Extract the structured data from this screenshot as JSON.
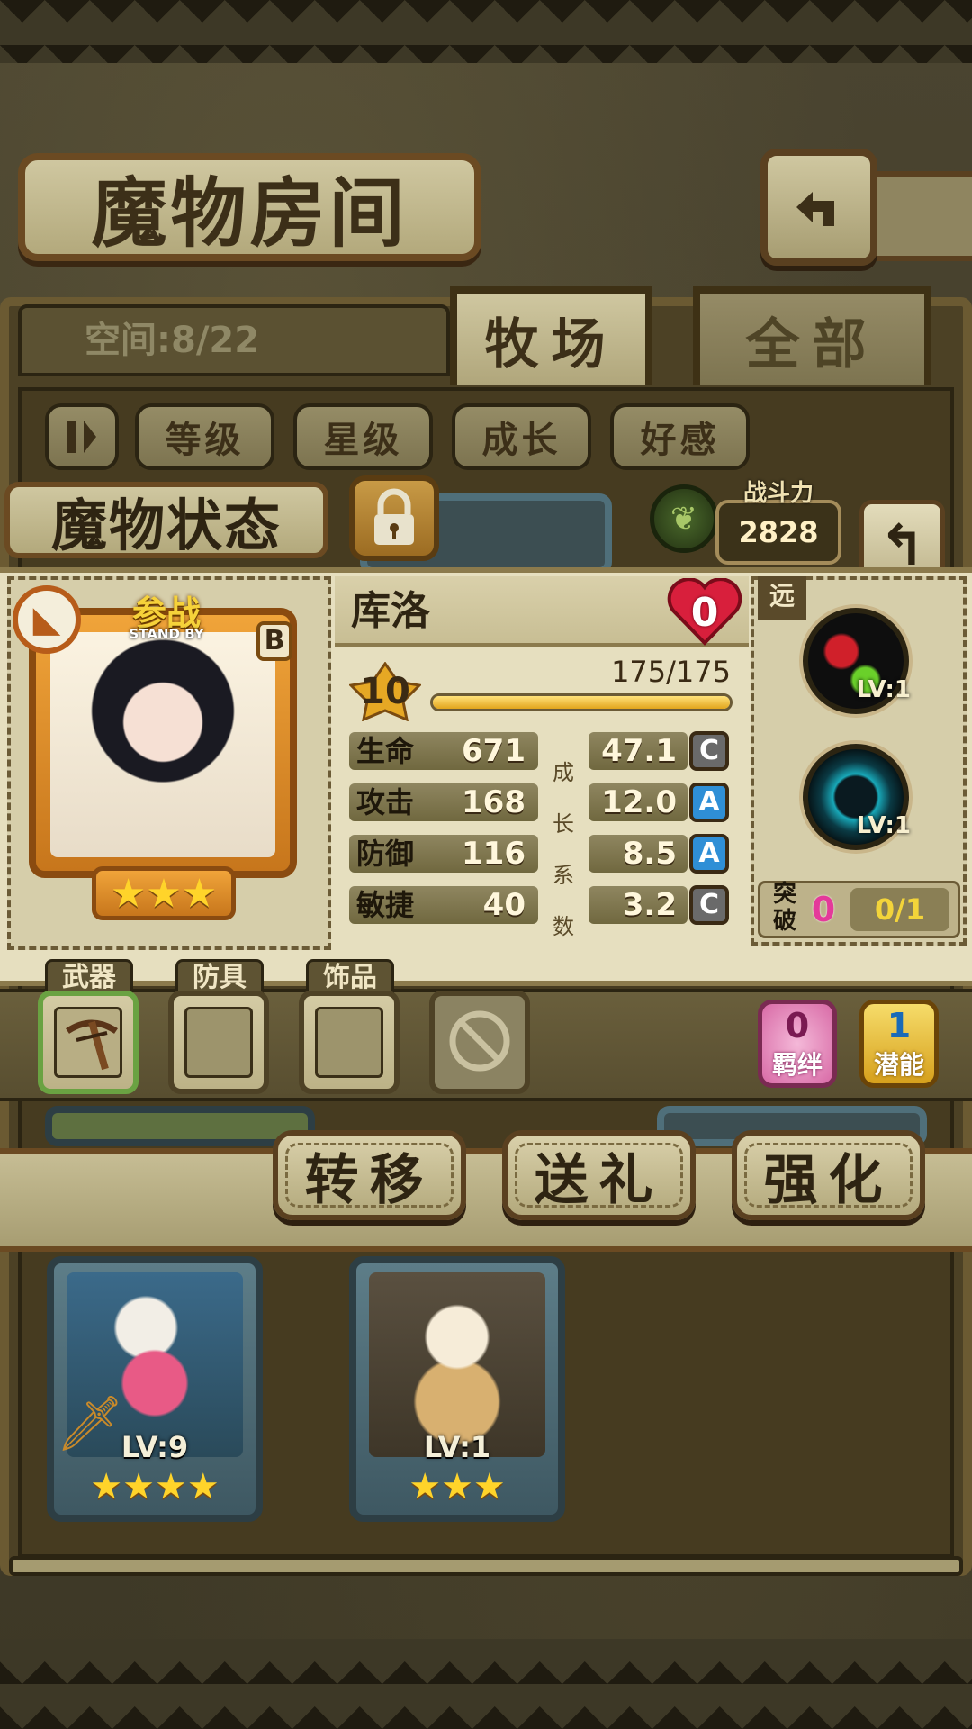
{
  "header": {
    "title": "魔物房间",
    "back_icon": "⎗"
  },
  "space": {
    "label": "空间:8/22"
  },
  "tabs": [
    {
      "label": "牧场",
      "active": true
    },
    {
      "label": "全部",
      "active": false
    }
  ],
  "filters": {
    "sort_icon": "⏸",
    "items": [
      "等级",
      "星级",
      "成长",
      "好感"
    ]
  },
  "status": {
    "title": "魔物状态",
    "power_label": "战斗力",
    "power_value": "2828",
    "back_glyph": "↰"
  },
  "monster": {
    "name": "库洛",
    "affinity": "0",
    "rank": "B",
    "badge_title": "参战",
    "badge_sub": "STAND BY",
    "stars": "★★★",
    "level": "10",
    "exp_text": "175/175",
    "exp_fraction": 1.0,
    "range": "远",
    "growth_vertical": "成长系数",
    "stats": [
      {
        "name": "生命",
        "value": "671",
        "growth": "47.1",
        "grade": "C"
      },
      {
        "name": "攻击",
        "value": "168",
        "growth": "12.0",
        "grade": "A"
      },
      {
        "name": "防御",
        "value": "116",
        "growth": "8.5",
        "grade": "A"
      },
      {
        "name": "敏捷",
        "value": "40",
        "growth": "3.2",
        "grade": "C"
      }
    ],
    "skills": [
      {
        "icon": "poison-skill-icon",
        "lv": "LV:1"
      },
      {
        "icon": "vortex-skill-icon",
        "lv": "LV:1"
      }
    ],
    "breakthrough": {
      "label": "突破",
      "value": "0",
      "count": "0/1"
    }
  },
  "equipment": {
    "slots": [
      {
        "label": "武器",
        "icon": "crossbow-icon"
      },
      {
        "label": "防具",
        "icon": ""
      },
      {
        "label": "饰品",
        "icon": ""
      }
    ],
    "bond": {
      "value": "0",
      "label": "羁绊"
    },
    "potential": {
      "value": "1",
      "label": "潜能"
    }
  },
  "actions": [
    "转移",
    "送礼",
    "强化"
  ],
  "roster": [
    {
      "lv": "LV:9",
      "stars": "★★★★"
    },
    {
      "lv": "LV:1",
      "stars": "★★★"
    }
  ],
  "colors": {
    "grade_A": "#2f8fd6",
    "grade_C": "#6a6a6a",
    "accent_gold": "#f3d43a",
    "heart_red": "#d81f3c"
  }
}
